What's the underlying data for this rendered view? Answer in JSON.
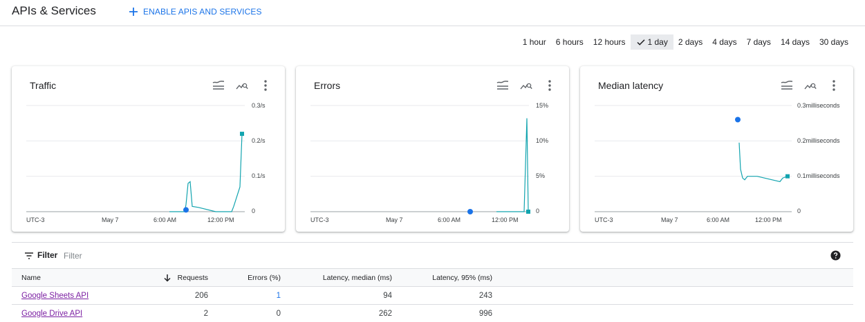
{
  "header": {
    "title": "APIs & Services",
    "enable_label": "ENABLE APIS AND SERVICES"
  },
  "time_range": {
    "options": [
      "1 hour",
      "6 hours",
      "12 hours",
      "1 day",
      "2 days",
      "4 days",
      "7 days",
      "14 days",
      "30 days"
    ],
    "selected": "1 day"
  },
  "cards": [
    {
      "title": "Traffic",
      "y_ticks": [
        "0.3/s",
        "0.2/s",
        "0.1/s",
        "0"
      ],
      "x_ticks": [
        "UTC-3",
        "May 7",
        "6:00 AM",
        "12:00 PM"
      ]
    },
    {
      "title": "Errors",
      "y_ticks": [
        "15%",
        "10%",
        "5%",
        "0"
      ],
      "x_ticks": [
        "UTC-3",
        "May 7",
        "6:00 AM",
        "12:00 PM"
      ]
    },
    {
      "title": "Median latency",
      "y_ticks": [
        "0.3milliseconds",
        "0.2milliseconds",
        "0.1milliseconds",
        "0"
      ],
      "x_ticks": [
        "UTC-3",
        "May 7",
        "6:00 AM",
        "12:00 PM"
      ]
    }
  ],
  "chart_data": [
    {
      "type": "line",
      "title": "Traffic",
      "ylim": [
        0,
        0.3
      ],
      "grid": true,
      "series": [
        {
          "color": "#12a4af",
          "y": [
            0,
            0,
            0,
            0.02,
            0.08,
            0.085,
            0.015,
            0.012,
            0,
            0,
            0.015,
            0.07,
            0.22
          ]
        },
        {
          "color": "#1a73e8",
          "y": [
            0.005
          ]
        }
      ]
    },
    {
      "type": "line",
      "title": "Errors",
      "ylim": [
        0,
        15
      ],
      "grid": true,
      "series": [
        {
          "color": "#12a4af",
          "y": [
            0,
            0,
            0,
            13.2,
            0
          ]
        },
        {
          "color": "#1a73e8",
          "y": [
            0
          ]
        }
      ]
    },
    {
      "type": "line",
      "title": "Median latency",
      "ylim": [
        0,
        0.3
      ],
      "grid": true,
      "series": [
        {
          "color": "#12a4af",
          "y": [
            0.195,
            0.12,
            0.095,
            0.09,
            0.1,
            0.1,
            0.085,
            0.095,
            0.1
          ]
        },
        {
          "color": "#1a73e8",
          "y": [
            0.26
          ]
        }
      ]
    }
  ],
  "filter": {
    "label": "Filter",
    "placeholder": "Filter"
  },
  "table": {
    "columns": [
      "Name",
      "Requests",
      "Errors (%)",
      "Latency, median (ms)",
      "Latency, 95% (ms)"
    ],
    "rows": [
      {
        "name": "Google Sheets API",
        "requests": "206",
        "errors": "1",
        "latency_median": "94",
        "latency_95": "243"
      },
      {
        "name": "Google Drive API",
        "requests": "2",
        "errors": "0",
        "latency_median": "262",
        "latency_95": "996"
      }
    ]
  },
  "colors": {
    "accent": "#1a73e8",
    "series_teal": "#12a4af",
    "link_visited": "#7b1fa2"
  }
}
